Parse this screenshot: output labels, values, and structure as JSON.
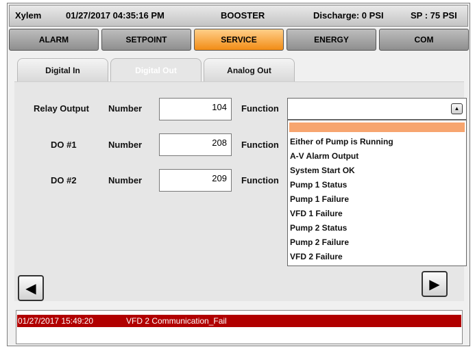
{
  "header": {
    "brand": "Xylem",
    "datetime": "01/27/2017 04:35:16 PM",
    "mode": "BOOSTER",
    "discharge": "Discharge: 0 PSI",
    "setpoint": "SP : 75 PSI"
  },
  "main_tabs": [
    {
      "label": "ALARM",
      "active": false
    },
    {
      "label": "SETPOINT",
      "active": false
    },
    {
      "label": "SERVICE",
      "active": true
    },
    {
      "label": "ENERGY",
      "active": false
    },
    {
      "label": "COM",
      "active": false
    }
  ],
  "sub_tabs": [
    {
      "label": "Digital In",
      "active": false
    },
    {
      "label": "Digital Out",
      "active": true
    },
    {
      "label": "Analog Out",
      "active": false
    }
  ],
  "form": {
    "rows": [
      {
        "label": "Relay Output",
        "number_label": "Number",
        "number_value": "104",
        "function_label": "Function"
      },
      {
        "label": "DO #1",
        "number_label": "Number",
        "number_value": "208",
        "function_label": "Function"
      },
      {
        "label": "DO #2",
        "number_label": "Number",
        "number_value": "209",
        "function_label": "Function"
      }
    ],
    "function_value": "",
    "function_options": [
      "",
      "Either of Pump is Running",
      "A-V Alarm Output",
      "System Start OK",
      "Pump 1 Status",
      "Pump 1 Failure",
      "VFD 1 Failure",
      "Pump 2 Status",
      "Pump 2 Failure",
      "VFD 2 Failure"
    ],
    "highlighted_option_index": 0
  },
  "nav": {
    "prev_icon": "left-triangle-icon",
    "next_icon": "right-triangle-icon"
  },
  "alarm": {
    "timestamp": "01/27/2017 15:49:20",
    "message": "VFD 2 Communication_Fail"
  },
  "colors": {
    "active_tab": "#f28c15",
    "highlight": "#f7a56f",
    "alarm_bg": "#b10000"
  }
}
